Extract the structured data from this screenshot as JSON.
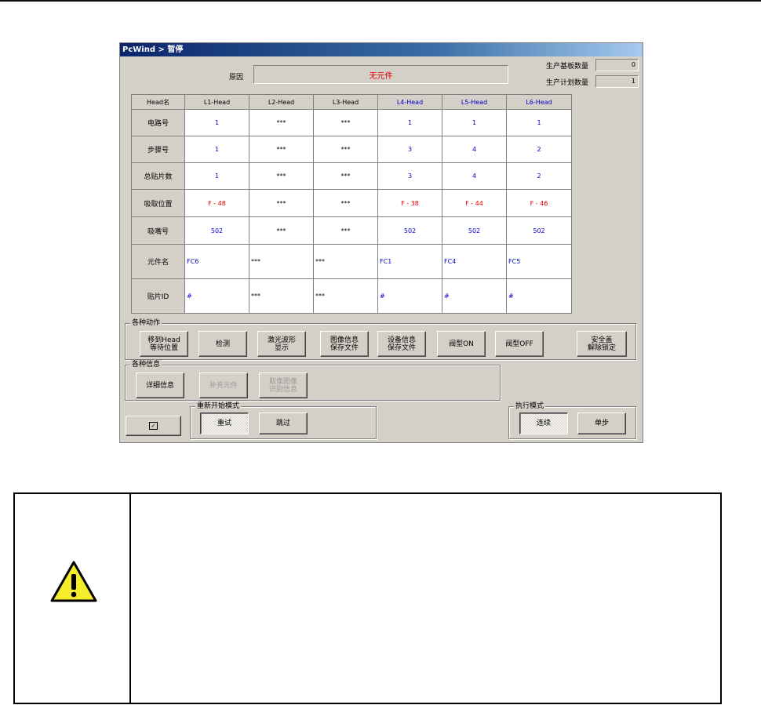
{
  "window": {
    "title": "PcWind > 暂停"
  },
  "status": {
    "reason_label": "原因",
    "reason_value": "无元件",
    "board_count_label": "生产基板数量",
    "board_count_value": "0",
    "plan_count_label": "生产计划数量",
    "plan_count_value": "1"
  },
  "grid": {
    "corner": "Head名",
    "columns": [
      "L1-Head",
      "L2-Head",
      "L3-Head",
      "L4-Head",
      "L5-Head",
      "L6-Head"
    ],
    "rows": [
      {
        "label": "电路号",
        "values": [
          "1",
          "***",
          "***",
          "1",
          "1",
          "1"
        ]
      },
      {
        "label": "步骤号",
        "values": [
          "1",
          "***",
          "***",
          "3",
          "4",
          "2"
        ]
      },
      {
        "label": "总贴片数",
        "values": [
          "1",
          "***",
          "***",
          "3",
          "4",
          "2"
        ]
      },
      {
        "label": "吸取位置",
        "values": [
          "F - 48",
          "***",
          "***",
          "F - 38",
          "F - 44",
          "F - 46"
        ]
      },
      {
        "label": "吸嘴号",
        "values": [
          "502",
          "***",
          "***",
          "502",
          "502",
          "502"
        ]
      },
      {
        "label": "元件名",
        "values": [
          "FC6",
          "***",
          "***",
          "FC1",
          "FC4",
          "FC5"
        ]
      },
      {
        "label": "贴片ID",
        "values": [
          "#",
          "***",
          "***",
          "#",
          "#",
          "#"
        ]
      }
    ]
  },
  "actions": {
    "title": "各种动作",
    "move_head_line1": "移到Head",
    "move_head_line2": "等待位置",
    "detect": "检测",
    "laser_line1": "激光波形",
    "laser_line2": "显示",
    "image_line1": "图像信息",
    "image_line2": "保存文件",
    "device_line1": "设备信息",
    "device_line2": "保存文件",
    "valve_on": "阀型ON",
    "valve_off": "阀型OFF",
    "safety_line1": "安全盖",
    "safety_line2": "解除锁定"
  },
  "info": {
    "title": "各种信息",
    "detail": "详细信息",
    "supply": "补充元件",
    "recog_line1": "取像图像",
    "recog_line2": "识别信息"
  },
  "restart": {
    "title": "重新开始模式",
    "retry": "重试",
    "skip": "跳过"
  },
  "exec": {
    "title": "执行模式",
    "continuous": "连续",
    "step": "单步"
  },
  "icons": {
    "checkbox_button": "check-icon",
    "warning": "warning-triangle-icon"
  },
  "colors": {
    "title_bar": "#0a246a",
    "face": "#d4d0c8",
    "value_blue": "#0000cc",
    "value_red": "#e00000",
    "warning_fill": "#f5ec2a"
  }
}
